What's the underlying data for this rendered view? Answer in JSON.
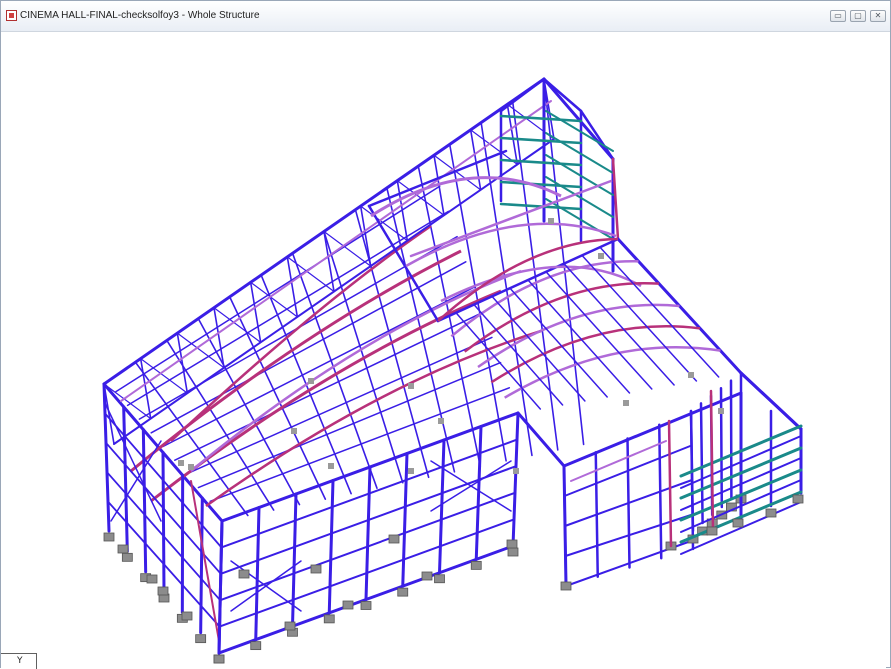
{
  "window": {
    "title": "CINEMA HALL-FINAL-checksolfoy3 - Whole Structure",
    "controls": {
      "minimize": "▭",
      "maximize": "▢",
      "close": "✕"
    }
  },
  "view": {
    "axis_label": "Y",
    "colors": {
      "member": "#3a1ee6",
      "member_light": "#6a5cf0",
      "beam": "#b8317a",
      "rafter": "#b06ad8",
      "bracing": "#1a8a8a",
      "support": "#8c8c8c",
      "background": "#ffffff"
    }
  }
}
